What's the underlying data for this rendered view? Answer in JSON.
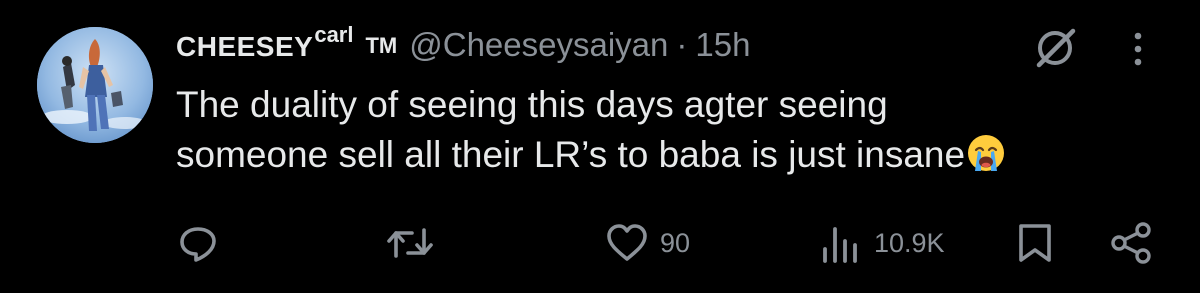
{
  "author": {
    "display_name": "CHEESEY",
    "display_name_sup": "carl",
    "trademark": "TM",
    "handle": "@Cheeseysaiyan",
    "separator": "·",
    "time": "15h"
  },
  "tweet": {
    "line1": "The duality of seeing this days agter seeing",
    "line2": "someone sell all their LR’s to baba is just insane",
    "emoji": "loudly-crying-face"
  },
  "actions": {
    "reply": {
      "icon": "reply-icon",
      "count": ""
    },
    "retweet": {
      "icon": "retweet-icon",
      "count": ""
    },
    "like": {
      "icon": "heart-icon",
      "count": "90"
    },
    "views": {
      "icon": "views-icon",
      "count": "10.9K"
    },
    "bookmark": {
      "icon": "bookmark-icon"
    },
    "share": {
      "icon": "share-icon"
    }
  },
  "header_icons": {
    "grok": "grok-icon",
    "more": "more-icon"
  },
  "colors": {
    "background": "#000000",
    "text": "#e7e9ea",
    "secondary": "#8b9198"
  }
}
